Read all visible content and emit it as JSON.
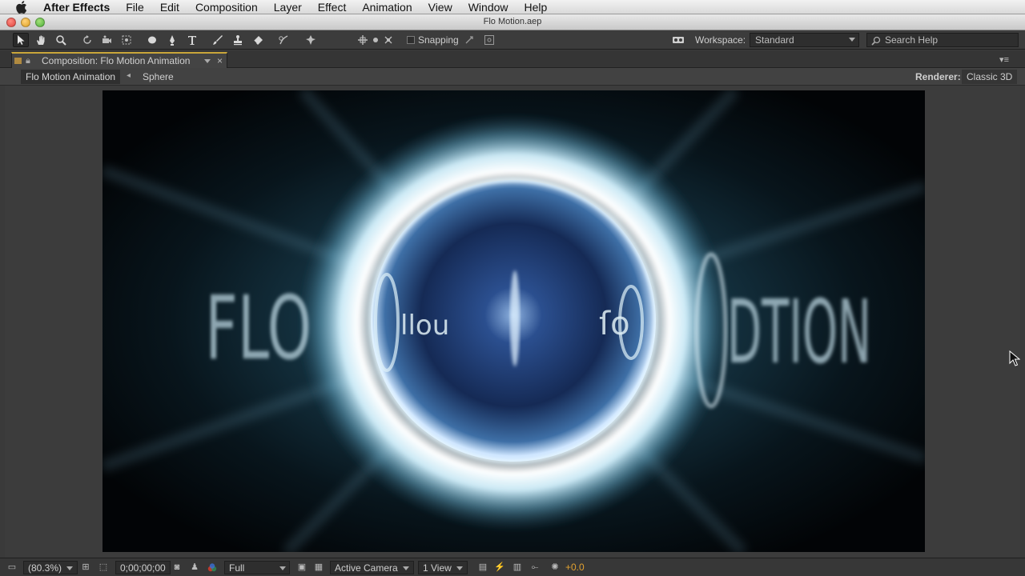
{
  "menubar": {
    "app_name": "After Effects",
    "items": [
      "File",
      "Edit",
      "Composition",
      "Layer",
      "Effect",
      "Animation",
      "View",
      "Window",
      "Help"
    ]
  },
  "window": {
    "title": "Flo Motion.aep"
  },
  "toolbar": {
    "tools": [
      "selection-tool",
      "hand-tool",
      "zoom-tool",
      "rotation-tool",
      "camera-orbit-tool",
      "pan-behind-tool",
      "ellipse-tool",
      "pen-tool",
      "type-tool",
      "brush-tool",
      "clone-stamp-tool",
      "eraser-tool",
      "roto-brush-tool",
      "puppet-pin-tool"
    ],
    "snapping_label": "Snapping",
    "workspace_label": "Workspace:",
    "workspace_value": "Standard",
    "search_placeholder": "Search Help"
  },
  "panel": {
    "tab_title": "Composition: Flo Motion Animation",
    "breadcrumbs": [
      "Flo Motion Animation",
      "Sphere"
    ],
    "renderer_label": "Renderer:",
    "renderer_value": "Classic 3D"
  },
  "frame": {
    "text_left": "FLO",
    "text_right": "DTION",
    "inner_left": "llou",
    "inner_right": "ſo",
    "colors": {
      "glow": "#cfefff",
      "sphere": "#1e3f7a",
      "bg": "#000000"
    }
  },
  "status": {
    "zoom": "(80.3%)",
    "timecode": "0;00;00;00",
    "resolution": "Full",
    "camera": "Active Camera",
    "views": "1 View",
    "exposure": "+0.0"
  }
}
